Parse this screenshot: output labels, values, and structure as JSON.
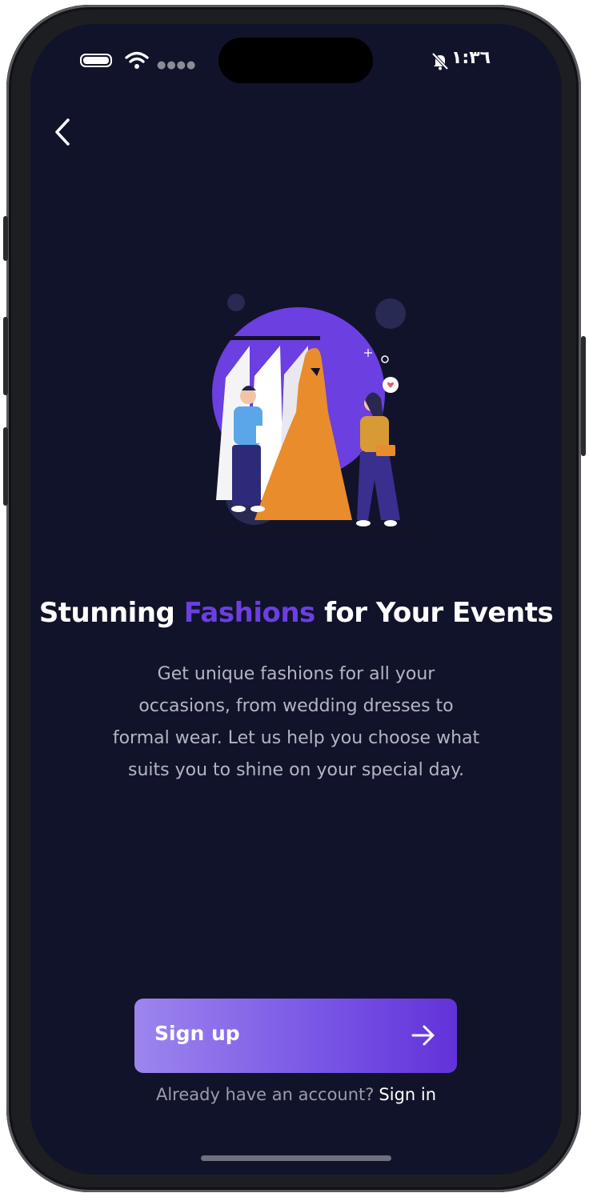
{
  "status_bar": {
    "time": "١:٣٦",
    "icons": [
      "battery-icon",
      "wifi-icon",
      "signal-dots-icon",
      "bell-slash-icon"
    ]
  },
  "header": {
    "back_icon": "chevron-left-icon"
  },
  "onboarding": {
    "title_before": "Stunning ",
    "title_highlight": "Fashions",
    "title_after": " for Your Events",
    "description": "Get unique fashions for all your occasions, from wedding dresses to formal wear. Let us help you choose what suits you to shine on your special day."
  },
  "actions": {
    "signup_label": "Sign up",
    "signup_icon": "arrow-right-icon",
    "signin_prompt": "Already have an account?",
    "signin_label": "Sign in"
  },
  "colors": {
    "background": "#11132a",
    "accent": "#6b3fe0",
    "button_gradient_start": "#9d85ee",
    "button_gradient_end": "#6232d9",
    "muted_text": "#b3b5c2"
  }
}
